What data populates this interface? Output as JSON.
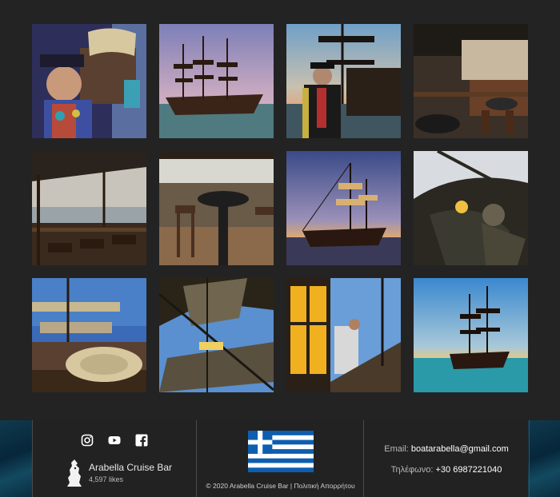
{
  "gallery": {
    "items": [
      {
        "alt": "pirate-portrait"
      },
      {
        "alt": "pirate-ship-sailing"
      },
      {
        "alt": "captain-on-deck"
      },
      {
        "alt": "ship-bar-interior"
      },
      {
        "alt": "deck-seating"
      },
      {
        "alt": "deck-bar-stools"
      },
      {
        "alt": "ship-at-sunset"
      },
      {
        "alt": "figurehead"
      },
      {
        "alt": "rope-and-masts"
      },
      {
        "alt": "rigging-sails"
      },
      {
        "alt": "lantern-and-rigging"
      },
      {
        "alt": "ship-at-sea"
      }
    ]
  },
  "footer": {
    "social": [
      "instagram-icon",
      "youtube-icon",
      "facebook-icon"
    ],
    "page_name": "Arabella Cruise Bar",
    "likes": "4,597 likes",
    "copyright": "© 2020 Arabella Cruise Bar",
    "separator": "|",
    "privacy": "Πολιτική Απορρήτου",
    "email_label": "Email:",
    "email": "boatarabella@gmail.com",
    "phone_label": "Τηλέφωνο:",
    "phone": "+30 6987221040"
  },
  "colors": {
    "background": "#232323",
    "footer": "#222222",
    "flag_blue": "#0d5eaf"
  }
}
